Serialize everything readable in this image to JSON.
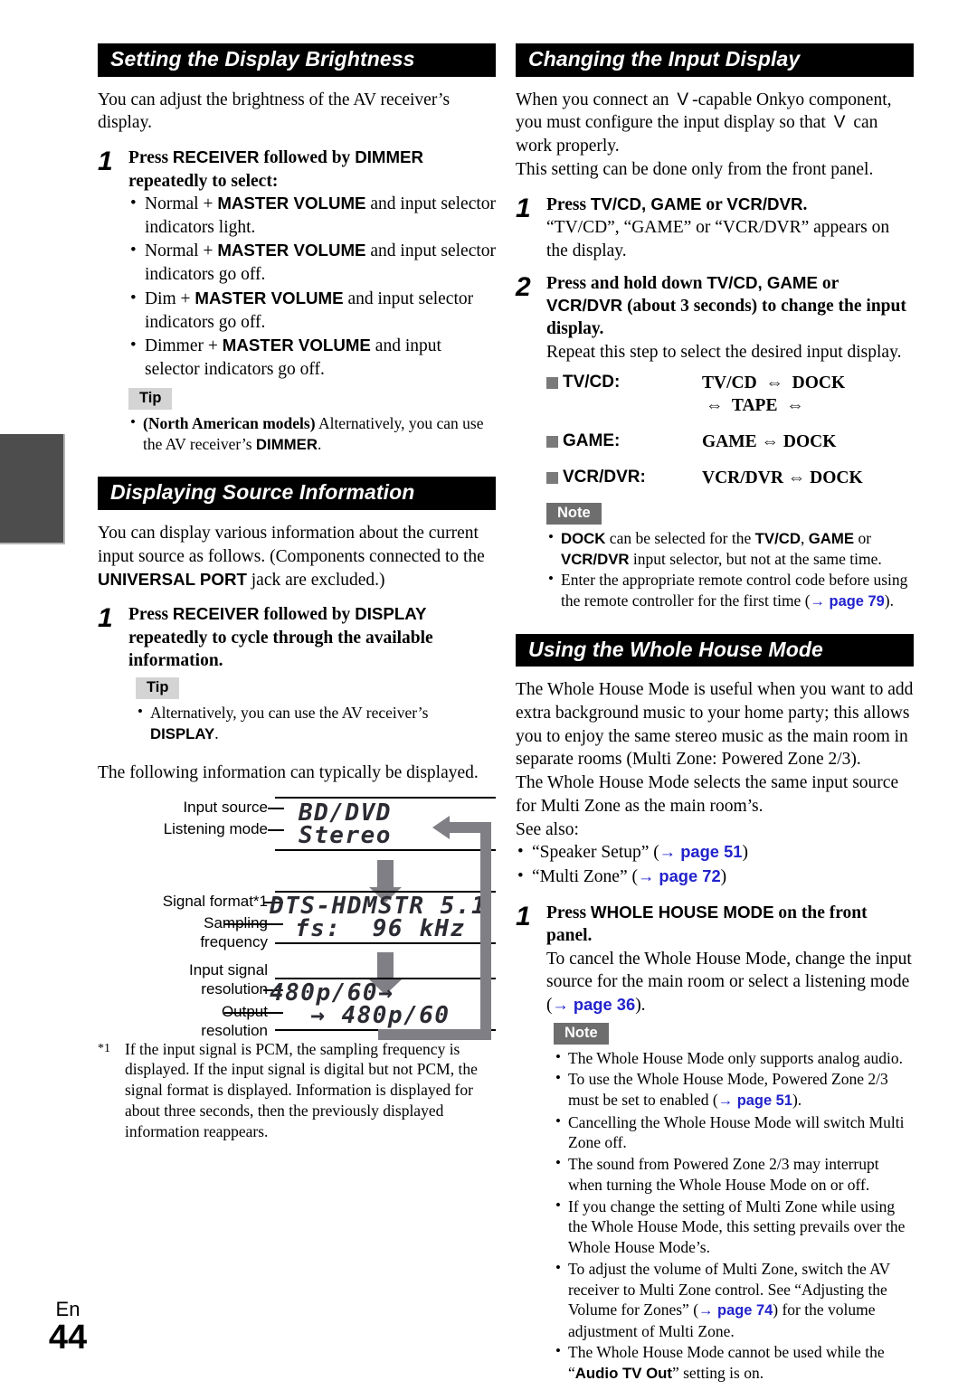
{
  "page": {
    "lang_label": "En",
    "number": "44"
  },
  "left_column": {
    "section1": {
      "heading": "Setting the Display Brightness",
      "intro": "You can adjust the brightness of the AV receiver’s display.",
      "step1": {
        "num": "1",
        "head_1": "Press ",
        "head_b1": "RECEIVER",
        "head_2": " followed by ",
        "head_b2": "DIMMER",
        "head_3": " repeatedly to select:"
      },
      "bullets": [
        {
          "pre": "Normal + ",
          "bold": "MASTER VOLUME",
          "post": " and input selector indicators light."
        },
        {
          "pre": "Normal + ",
          "bold": "MASTER VOLUME",
          "post": " and input selector indicators go off."
        },
        {
          "pre": "Dim + ",
          "bold": "MASTER VOLUME",
          "post": " and input selector indicators go off."
        },
        {
          "pre": "Dimmer + ",
          "bold": "MASTER VOLUME",
          "post": " and input selector indicators go off."
        }
      ],
      "tip_badge": "Tip",
      "tip_bullet": {
        "bold1": "(North American models)",
        "mid": " Alternatively, you can use the AV receiver’s ",
        "bold2": "DIMMER",
        "end": "."
      }
    },
    "section2": {
      "heading": "Displaying Source Information",
      "intro_1": "You can display various information about the current input source as follows. (Components connected to the ",
      "intro_b": "UNIVERSAL PORT",
      "intro_2": " jack are excluded.)",
      "step1": {
        "num": "1",
        "head_1": "Press ",
        "head_b1": "RECEIVER",
        "head_2": " followed by ",
        "head_b2": "DISPLAY",
        "head_3": " repeatedly to cycle through the available information."
      },
      "tip_badge": "Tip",
      "tip_bullet": {
        "pre": "Alternatively, you can use the AV receiver’s ",
        "bold": "DISPLAY",
        "post": "."
      },
      "lead_in": "The following information can typically be displayed.",
      "diagram": {
        "labels": {
          "input_source": "Input source",
          "listening_mode": "Listening mode",
          "signal_format": "Signal format*1",
          "sampling_line1": "Sampling",
          "sampling_line2": "frequency",
          "input_res_line1": "Input signal",
          "input_res_line2": "resolution",
          "output_res_line1": "Output",
          "output_res_line2": "resolution"
        },
        "screens": [
          {
            "line1": "BD/DVD",
            "line2": "Stereo"
          },
          {
            "line1": "DTS-HDMSTR 5.1",
            "line2": "fs:  96 kHz"
          },
          {
            "line1": "480p/60→",
            "line2": " → 480p/60"
          }
        ]
      },
      "footnote": {
        "mark": "*1",
        "text": "If the input signal is PCM, the sampling frequency is displayed. If the input signal is digital but not PCM, the signal format is displayed. Information is displayed for about three seconds, then the previously displayed information reappears."
      }
    }
  },
  "right_column": {
    "section3": {
      "heading": "Changing the Input Display",
      "intro_1": "When you connect an ",
      "rihd_glyph": "V",
      "intro_2": "-capable Onkyo component, you must configure the input display so that ",
      "intro_3": " can work properly.",
      "intro_4": "This setting can be done only from the front panel.",
      "step1": {
        "num": "1",
        "head_1": "Press ",
        "head_b1": "TV/CD, GAME",
        "head_2": " or ",
        "head_b2": "VCR/DVR",
        "head_3": ".",
        "sub": "“TV/CD”, “GAME” or “VCR/DVR” appears on the display."
      },
      "step2": {
        "num": "2",
        "head_1": "Press and hold down ",
        "head_b1": "TV/CD, GAME",
        "head_2": " or ",
        "head_b2": "VCR/DVR",
        "head_3": " (about 3 seconds) to change the input display.",
        "sub": "Repeat this step to select the desired input display."
      },
      "cycles": [
        {
          "key": "TV/CD:",
          "line1": "TV/CD  ⇔  DOCK",
          "line2": "⇔  TAPE  ⇔"
        },
        {
          "key": "GAME:",
          "line1": "GAME ⇔ DOCK",
          "line2": ""
        },
        {
          "key": "VCR/DVR:",
          "line1": "VCR/DVR ⇔ DOCK",
          "line2": ""
        }
      ],
      "note_badge": "Note",
      "notes": [
        {
          "b1": "DOCK",
          "t1": " can be selected for the ",
          "b2": "TV/CD",
          "t2": ", ",
          "b3": "GAME",
          "t3": " or ",
          "b4": "VCR/DVR",
          "t4": " input selector, but not at the same time."
        },
        {
          "t1": "Enter the appropriate remote control code before using the remote controller for the first time (",
          "link": "→ page 79",
          "t2": ")."
        }
      ]
    },
    "section4": {
      "heading": "Using the Whole House Mode",
      "para1": "The Whole House Mode is useful when you want to add extra background music to your home party; this allows you to enjoy the same stereo music as the main room in separate rooms (Multi Zone: Powered Zone 2/3).",
      "para2": "The Whole House Mode selects the same input source for Multi Zone as the main room’s.",
      "para3": "See also:",
      "see_also": [
        {
          "text": "“Speaker Setup” (",
          "link": "→ page 51",
          "tail": ")"
        },
        {
          "text": "“Multi Zone” (",
          "link": "→ page 72",
          "tail": ")"
        }
      ],
      "step1": {
        "num": "1",
        "head_1": "Press ",
        "head_b1": "WHOLE HOUSE MODE",
        "head_2": " on the front panel.",
        "sub_1": "To cancel the Whole House Mode, change the input source for the main room or select a listening mode (",
        "sub_link": "→ page 36",
        "sub_2": ")."
      },
      "note_badge": "Note",
      "notes": [
        {
          "t1": "The Whole House Mode only supports analog audio."
        },
        {
          "t1": "To use the Whole House Mode, Powered Zone 2/3 must be set to enabled (",
          "link": "→ page 51",
          "t2": ")."
        },
        {
          "t1": "Cancelling the Whole House Mode will switch Multi Zone off."
        },
        {
          "t1": "The sound from Powered Zone 2/3 may interrupt when turning the Whole House Mode on or off."
        },
        {
          "t1": "If you change the setting of Multi Zone while using the Whole House Mode, this setting prevails over the Whole House Mode’s."
        },
        {
          "t1": "To adjust the volume of Multi Zone, switch the AV receiver to Multi Zone control. See “Adjusting the Volume for Zones” (",
          "link": "→ page 74",
          "t2": ") for the volume adjustment of Multi Zone."
        },
        {
          "t1": "The Whole House Mode cannot be used while the “",
          "b1": "Audio TV Out",
          "t2": "” setting is on."
        }
      ]
    }
  },
  "colors": {
    "link": "#2222cc",
    "tab": "#4d4d4d",
    "note_badge": "#6e6e6e",
    "tip_badge": "#d4d4d4",
    "arrow": "#7f7f85"
  }
}
